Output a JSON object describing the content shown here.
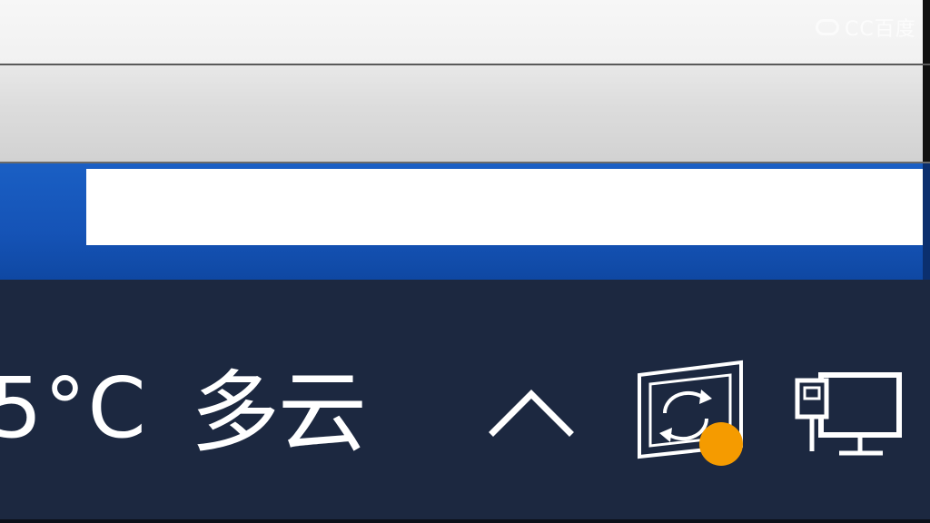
{
  "watermark": {
    "text": "CC百度"
  },
  "taskbar": {
    "weather": {
      "temperature": "5°C",
      "condition": "多云"
    },
    "tray_icons": [
      {
        "name": "chevron-up-icon"
      },
      {
        "name": "app-sync-icon",
        "badge_color": "#f59b00"
      },
      {
        "name": "network-icon"
      }
    ]
  },
  "colors": {
    "taskbar_bg": "#1c2840",
    "accent_blue": "#1553b6",
    "badge_orange": "#f59b00"
  }
}
